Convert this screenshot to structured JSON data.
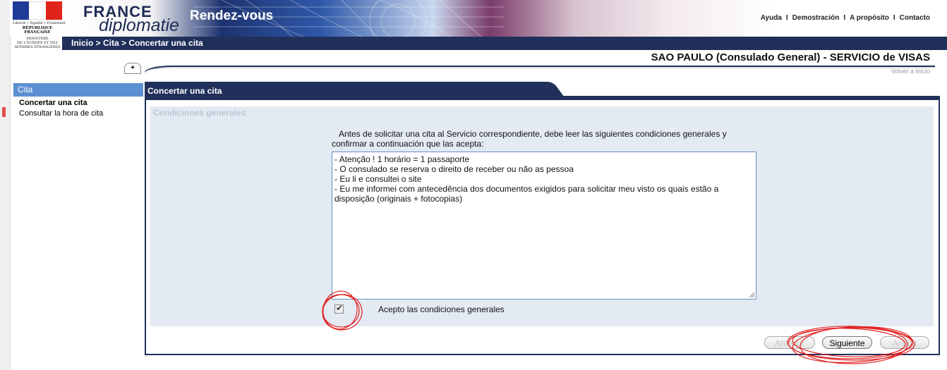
{
  "header": {
    "logo": {
      "motto": "Liberté • Égalité • Fraternité",
      "republic": "RÉPUBLIQUE FRANÇAISE",
      "ministry_lines": [
        "MINISTÈRE",
        "DE L'EUROPE ET DES",
        "AFFAIRES ÉTRANGÈRES"
      ]
    },
    "brand_line1": "FRANCE",
    "brand_line2": "diplomatie",
    "app_title": "Rendez-vous",
    "links": [
      "Ayuda",
      "Demostración",
      "A propósito",
      "Contacto"
    ]
  },
  "breadcrumb": "Inicio > Cita > Concertar una cita",
  "consulate_title": "SAO PAULO (Consulado General) - SERVICIO de VISAS",
  "back_home": "Volver a inicio",
  "toggle_label": "+",
  "sidebar": {
    "heading": "Cita",
    "items": [
      {
        "label": "Concertar una cita",
        "active": true
      },
      {
        "label": "Consultar la hora de cita",
        "active": false
      }
    ]
  },
  "main": {
    "tab_title": "Concertar una cita",
    "section_title": "Condiciones generales",
    "intro_line1": "Antes de solicitar una cita al Servicio correspondiente, debe leer las siguientes condiciones generales y",
    "intro_line2": "confirmar a continuación que las acepta:",
    "conditions_text": "- Atenção ! 1 horário = 1 passaporte\n- O consulado se reserva o direito de receber ou não as pessoa\n- Eu li e consultei o site\n- Eu me informei com antecedência dos documentos exigidos para solicitar meu visto os quais estão a\ndisposição (originais + fotocopias)",
    "accept_label": "Acepto las condiciones generales",
    "accept_checked": true
  },
  "buttons": {
    "prev": "Anterior",
    "next": "Siguiente",
    "cancel": "Anular"
  },
  "colors": {
    "navy": "#20305a",
    "nav_blue": "#5b8fd2",
    "panel_bg": "#e3eaf2",
    "annotation_red": "#e02020"
  }
}
